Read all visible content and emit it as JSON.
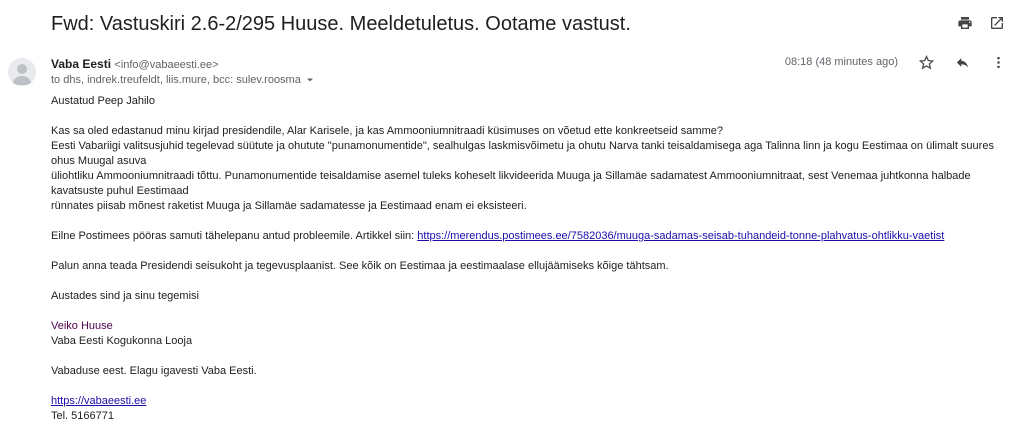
{
  "email": {
    "subject": "Fwd: Vastuskiri 2.6-2/295 Huuse. Meeldetuletus. Ootame vastust.",
    "sender_name": "Vaba Eesti",
    "sender_email": "<info@vabaeesti.ee>",
    "recipients": "to dhs, indrek.treufeldt, liis.mure, bcc: sulev.roosma",
    "time": "08:18 (48 minutes ago)",
    "body": {
      "greeting": "Austatud Peep Jahilo",
      "p1_l1": "Kas sa oled edastanud minu kirjad presidendile, Alar Karisele, ja kas Ammooniumnitraadi küsimuses on võetud ette konkreetseid samme?",
      "p1_l2": "Eesti Vabariigi valitsusjuhid tegelevad süütute ja ohutute \"punamonumentide\", sealhulgas laskmisvõimetu ja ohutu Narva tanki teisaldamisega aga Talinna linn ja kogu Eestimaa on ülimalt suures ohus Muugal asuva",
      "p1_l3": "üliohtliku Ammooniumnitraadi tõttu. Punamonumentide teisaldamise asemel tuleks koheselt likvideerida Muuga ja Sillamäe sadamatest Ammooniumnitraat, sest Venemaa juhtkonna halbade kavatsuste puhul Eestimaad",
      "p1_l4": "rünnates piisab mõnest raketist Muuga ja Sillamäe sadamatesse ja Eestimaad enam ei eksisteeri.",
      "p2_text": "Eilne Postimees pööras samuti tähelepanu antud probleemile. Artikkel siin: ",
      "p2_link": "https://merendus.postimees.ee/7582036/muuga-sadamas-seisab-tuhandeid-tonne-plahvatus-ohtlikku-vaetist",
      "p3": "Palun anna teada Presidendi seisukoht ja tegevusplaanist. See kõik on Eestimaa ja eestimaalase ellujäämiseks kõige tähtsam.",
      "p4": "Austades sind ja sinu tegemisi",
      "sig_name": "Veiko Huuse",
      "sig_title": "Vaba Eesti Kogukonna Looja",
      "motto": "Vabaduse eest. Elagu igavesti Vaba Eesti.",
      "website": "https://vabaeesti.ee",
      "phone": "Tel. 5166771"
    }
  },
  "icons": {
    "print": "print-icon",
    "open_new_window": "open-in-new-window-icon",
    "star": "star-icon",
    "reply": "reply-icon",
    "more": "more-vertical-icon",
    "recipients_caret": "caret-down-icon",
    "avatar": "avatar-person-icon"
  }
}
